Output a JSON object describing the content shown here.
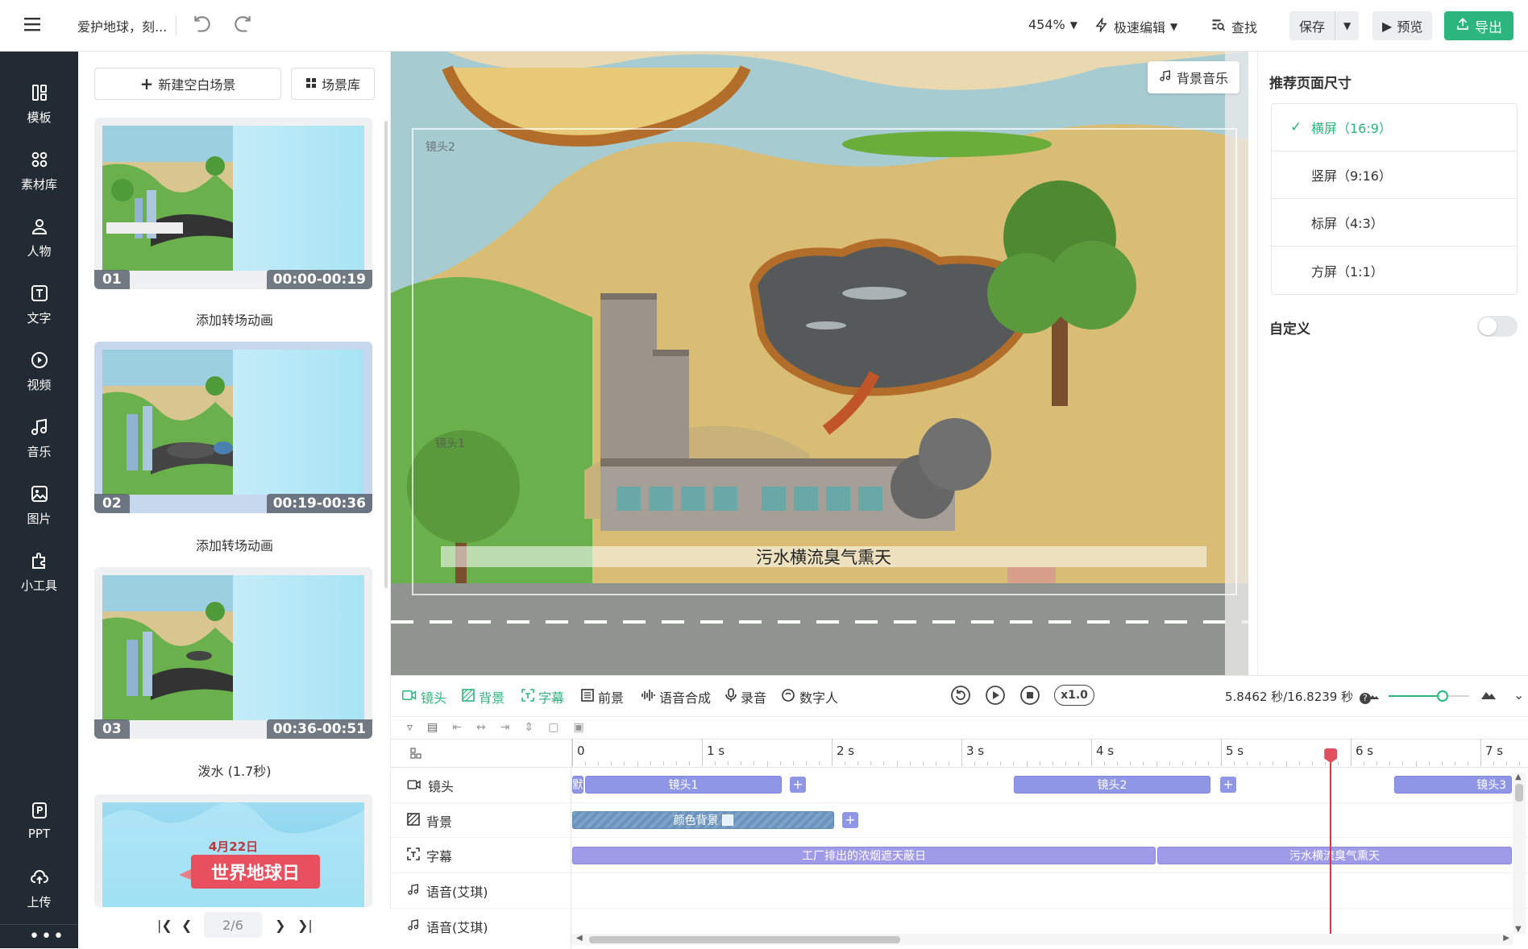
{
  "topbar": {
    "doc_title": "爱护地球，刻...",
    "zoom": "454%",
    "edit_mode": "极速编辑",
    "find": "查找",
    "save": "保存",
    "preview": "预览",
    "export": "导出"
  },
  "nav": [
    {
      "label": "模板",
      "icon": "template-icon"
    },
    {
      "label": "素材库",
      "icon": "grid-icon"
    },
    {
      "label": "人物",
      "icon": "person-icon"
    },
    {
      "label": "文字",
      "icon": "text-icon"
    },
    {
      "label": "视频",
      "icon": "video-icon"
    },
    {
      "label": "音乐",
      "icon": "music-icon"
    },
    {
      "label": "图片",
      "icon": "image-icon"
    },
    {
      "label": "小工具",
      "icon": "puzzle-icon"
    },
    {
      "label": "PPT",
      "icon": "ppt-icon"
    },
    {
      "label": "上传",
      "icon": "upload-icon"
    }
  ],
  "scenes": {
    "new_blank": "新建空白场景",
    "library": "场景库",
    "items": [
      {
        "num": "01",
        "dur": "00:00-00:19",
        "after": "添加转场动画"
      },
      {
        "num": "02",
        "dur": "00:19-00:36",
        "after": "添加转场动画"
      },
      {
        "num": "03",
        "dur": "00:36-00:51",
        "after": "泼水 (1.7秒)"
      }
    ],
    "card4_date": "4月22日",
    "card4_title": "世界地球日",
    "pager": "2/6"
  },
  "canvas": {
    "bg_music": "背景音乐",
    "shot2": "镜头2",
    "shot1": "镜头1",
    "caption": "污水横流臭气熏天"
  },
  "right": {
    "title": "推荐页面尺寸",
    "options": [
      "横屏（16:9）",
      "竖屏（9:16）",
      "标屏（4:3）",
      "方屏（1:1）"
    ],
    "selected": 0,
    "custom": "自定义"
  },
  "timeline": {
    "tabs": [
      "镜头",
      "背景",
      "字幕",
      "前景",
      "语音合成",
      "录音",
      "数字人"
    ],
    "speed": "x1.0",
    "time": "5.8462 秒/16.8239 秒",
    "ticks": [
      "0",
      "1 s",
      "2 s",
      "3 s",
      "4 s",
      "5 s",
      "6 s",
      "7 s"
    ],
    "tracks": [
      "镜头",
      "背景",
      "字幕",
      "语音(艾琪)",
      "语音(艾琪)"
    ],
    "shot_default": "默",
    "shot_clips": [
      "镜头1",
      "镜头2",
      "镜头3"
    ],
    "bg_clip": "颜色背景",
    "sub_clips": [
      "工厂排出的浓烟遮天蔽日",
      "污水横流臭气熏天"
    ],
    "playhead_seconds": 5.8462
  }
}
